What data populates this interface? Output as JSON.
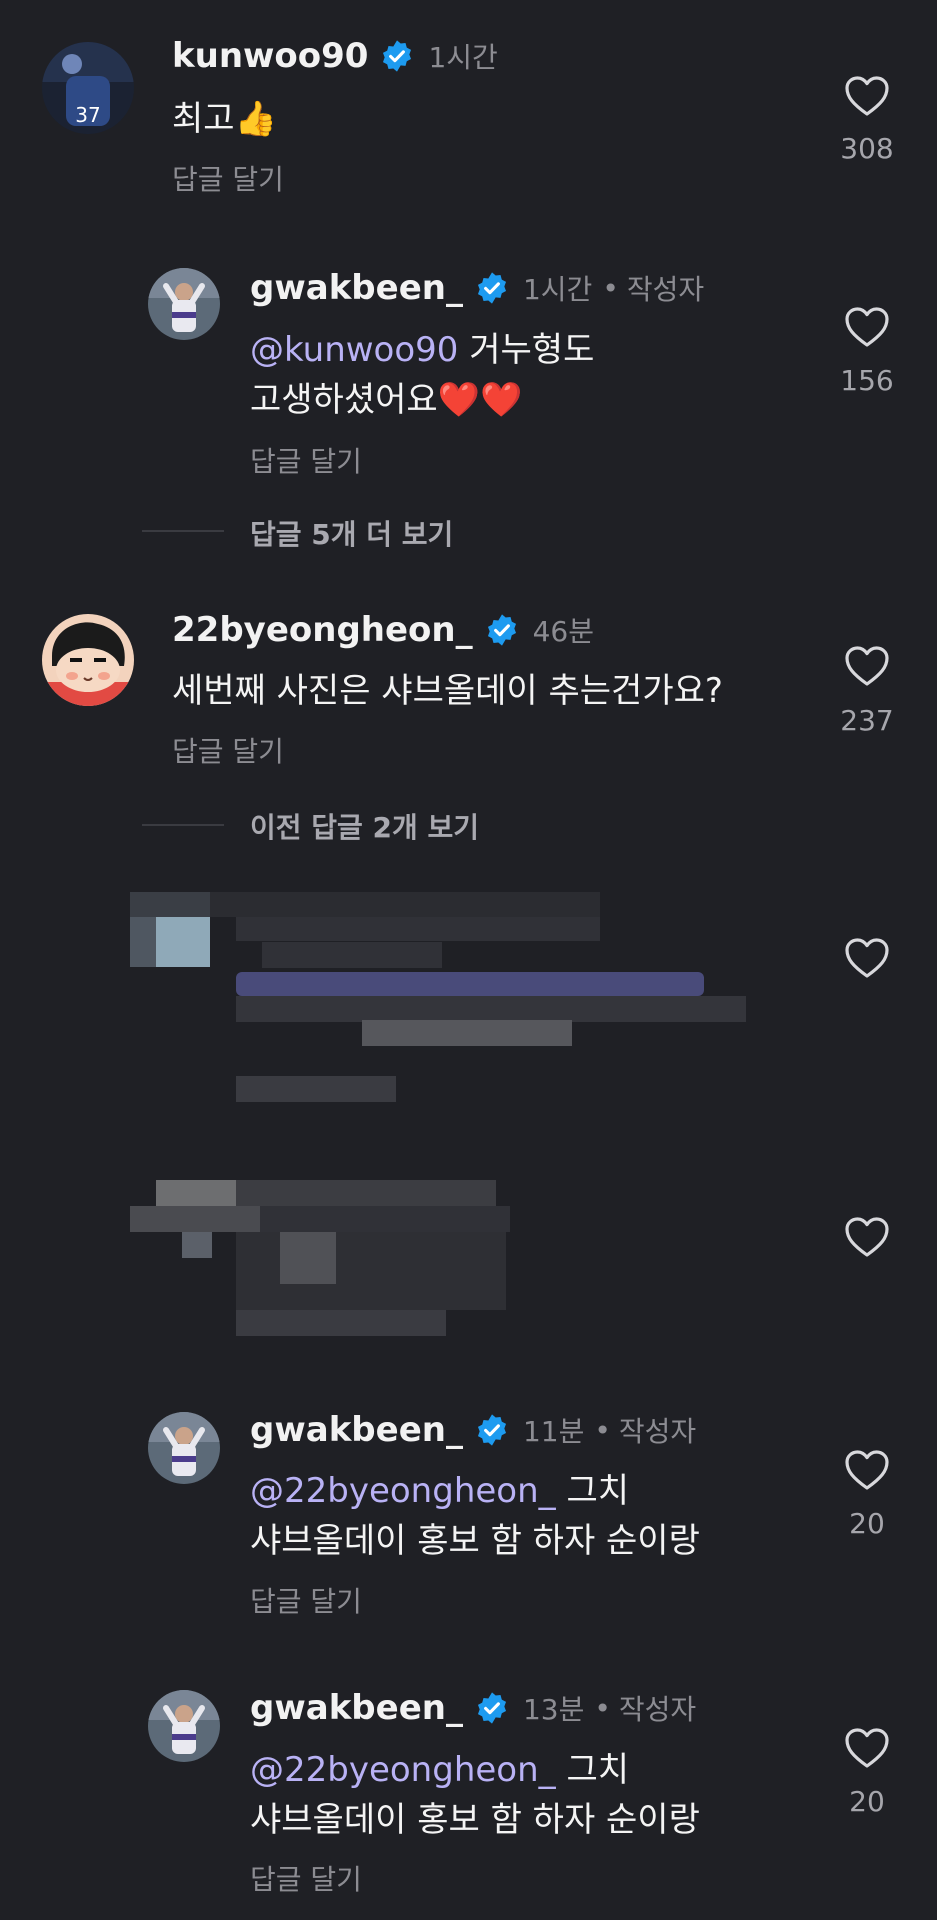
{
  "comments": [
    {
      "username": "kunwoo90",
      "time": "1시간",
      "text": "최고",
      "emoji": "👍",
      "reply": "답글 달기",
      "likes": "308"
    },
    {
      "username": "gwakbeen_",
      "time": "1시간",
      "author_badge": "작성자",
      "mention": "@kunwoo90",
      "text_line1": " 거누형도",
      "text_line2": "고생하셨어요",
      "emoji": "❤️❤️",
      "reply": "답글 달기",
      "likes": "156"
    },
    {
      "username": "22byeongheon_",
      "time": "46분",
      "text": "세번째 사진은 샤브올데이 추는건가요?",
      "reply": "답글 달기",
      "likes": "237"
    },
    {
      "username": "gwakbeen_",
      "time": "11분",
      "author_badge": "작성자",
      "mention": "@22byeongheon_",
      "text_line1": " 그치",
      "text_line2": "샤브올데이 홍보 함 하자 순이랑",
      "reply": "답글 달기",
      "likes": "20"
    },
    {
      "username": "gwakbeen_",
      "time": "13분",
      "author_badge": "작성자",
      "mention": "@22byeongheon_",
      "text_line1": " 그치",
      "text_line2": "샤브올데이 홍보 함 하자 순이랑",
      "reply": "답글 달기",
      "likes": "20"
    }
  ],
  "thread_links": {
    "more_replies": "답글 5개 더 보기",
    "previous_replies": "이전 답글 2개 보기"
  },
  "colors": {
    "background": "#1f2025",
    "mention": "#b9b2f5",
    "verified": "#1d9bf0",
    "secondary_text": "#8c8c92"
  },
  "icons": {
    "verified": "verified-badge-icon",
    "like": "heart-outline-icon",
    "mention": "threads-at-icon"
  }
}
